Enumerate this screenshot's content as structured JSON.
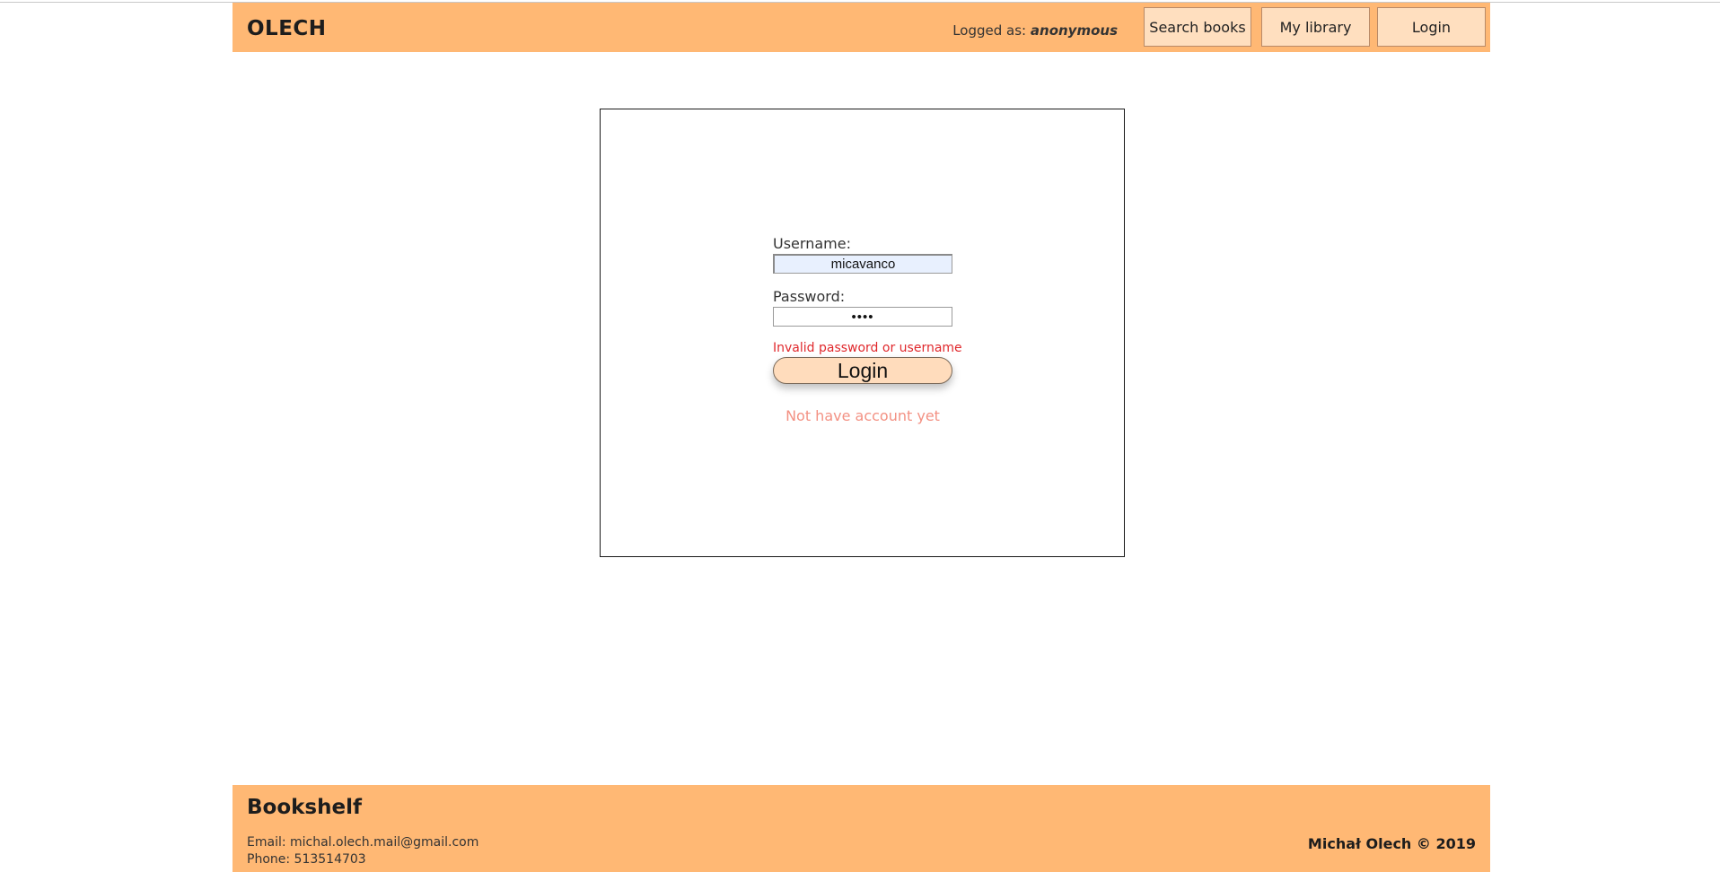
{
  "header": {
    "brand": "OLECH",
    "logged_prefix": "Logged as: ",
    "logged_user": "anonymous",
    "nav": {
      "search": "Search books",
      "library": "My library",
      "login": "Login"
    }
  },
  "login_form": {
    "username_label": "Username:",
    "username_value": "micavanco",
    "password_label": "Password:",
    "password_value": "••••",
    "error": "Invalid password or username",
    "submit_label": "Login",
    "signup_link": "Not have account yet"
  },
  "footer": {
    "title": "Bookshelf",
    "email": "Email: michal.olech.mail@gmail.com",
    "phone": "Phone: 513514703",
    "copyright": "Michał Olech © 2019"
  },
  "colors": {
    "accent": "#ffb874",
    "button_fill": "#ffdfbf",
    "error": "#e0282c",
    "link": "#f39183"
  }
}
